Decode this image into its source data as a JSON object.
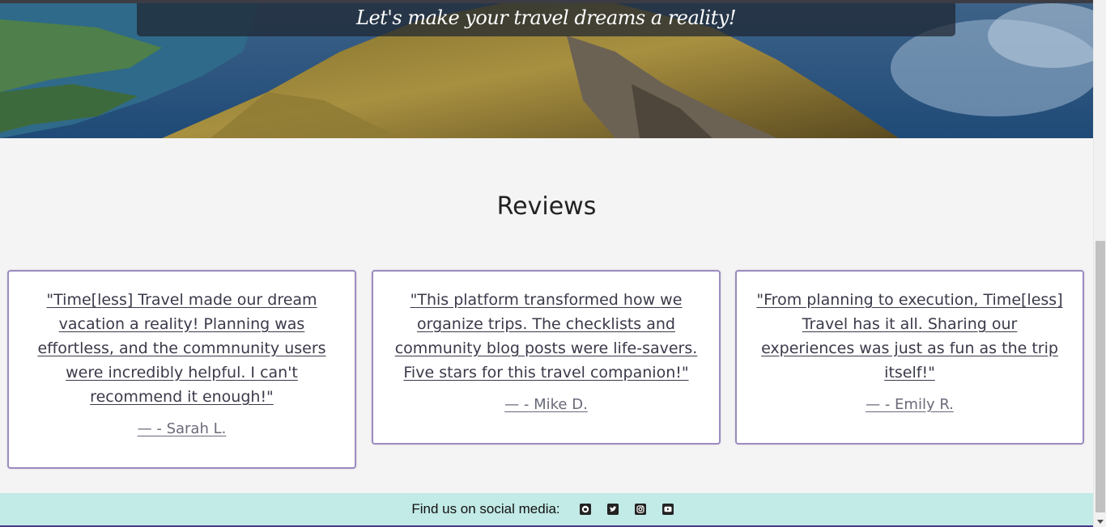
{
  "hero": {
    "tagline": "Let's make your travel dreams a reality!"
  },
  "reviews": {
    "title": "Reviews",
    "items": [
      {
        "quote": "\"Time[less] Travel made our dream vacation a reality! Planning was effortless, and the commnunity users were incredibly helpful. I can't recommend it enough!\"",
        "author": "— - Sarah L."
      },
      {
        "quote": "\"This platform transformed how we organize trips. The checklists and community blog posts were life-savers. Five stars for this travel companion!\"",
        "author": "— - Mike D."
      },
      {
        "quote": "\"From planning to execution, Time[less] Travel has it all. Sharing our experiences was just as fun as the trip itself!\"",
        "author": "— - Emily R."
      }
    ]
  },
  "footer": {
    "label": "Find us on social media:",
    "icons": [
      "github-icon",
      "twitter-icon",
      "instagram-icon",
      "youtube-icon"
    ]
  },
  "colors": {
    "card_border": "#9b8cc0",
    "footer_bg": "#c2eae6",
    "page_bg": "#f4f4f4"
  }
}
